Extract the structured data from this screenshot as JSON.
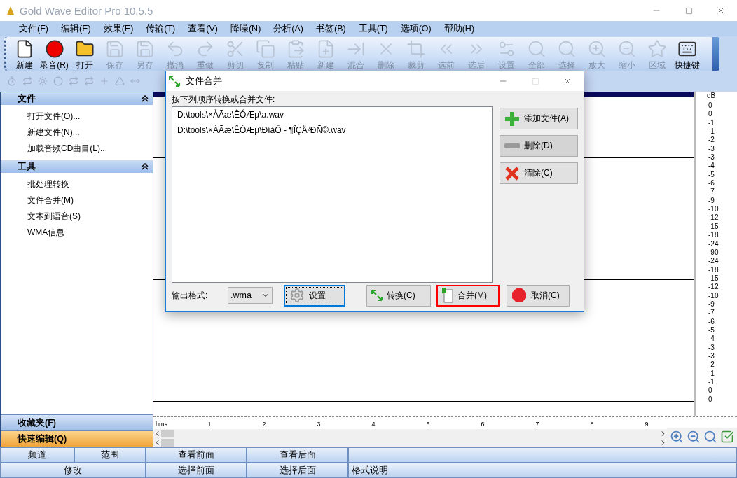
{
  "window": {
    "title": "Gold Wave Editor Pro 10.5.5"
  },
  "menu": [
    "文件(F)",
    "编辑(E)",
    "效果(E)",
    "传输(T)",
    "查看(V)",
    "降噪(N)",
    "分析(A)",
    "书签(B)",
    "工具(T)",
    "选项(O)",
    "帮助(H)"
  ],
  "toolbar": [
    {
      "label": "新建",
      "disabled": false
    },
    {
      "label": "录音(R)",
      "disabled": false
    },
    {
      "label": "打开",
      "disabled": false
    },
    {
      "label": "保存",
      "disabled": true
    },
    {
      "label": "另存",
      "disabled": true
    },
    {
      "label": "撤消",
      "disabled": true
    },
    {
      "label": "重做",
      "disabled": true
    },
    {
      "label": "剪切",
      "disabled": true
    },
    {
      "label": "复制",
      "disabled": true
    },
    {
      "label": "粘贴",
      "disabled": true
    },
    {
      "label": "新建",
      "disabled": true
    },
    {
      "label": "混合",
      "disabled": true
    },
    {
      "label": "删除",
      "disabled": true
    },
    {
      "label": "裁剪",
      "disabled": true
    },
    {
      "label": "选前",
      "disabled": true
    },
    {
      "label": "选后",
      "disabled": true
    },
    {
      "label": "设置",
      "disabled": true
    },
    {
      "label": "全部",
      "disabled": true
    },
    {
      "label": "选择",
      "disabled": true
    },
    {
      "label": "放大",
      "disabled": true
    },
    {
      "label": "缩小",
      "disabled": true
    },
    {
      "label": "区域",
      "disabled": true
    },
    {
      "label": "快捷键",
      "disabled": false
    }
  ],
  "sidebar": {
    "sections": [
      {
        "title": "文件",
        "expanded": true,
        "items": [
          "打开文件(O)...",
          "新建文件(N)...",
          "加载音频CD曲目(L)..."
        ]
      },
      {
        "title": "工具",
        "expanded": true,
        "items": [
          "批处理转换",
          "文件合并(M)",
          "文本到语音(S)",
          "WMA信息"
        ]
      }
    ],
    "panels": [
      {
        "label": "收藏夹(F)",
        "selected": false
      },
      {
        "label": "快速编辑(Q)",
        "selected": true
      }
    ]
  },
  "db_scale": {
    "unit": "dB",
    "labels": [
      "0",
      "0",
      "-1",
      "-1",
      "-2",
      "-3",
      "-3",
      "-4",
      "-5",
      "-6",
      "-7",
      "-9",
      "-10",
      "-12",
      "-15",
      "-18",
      "-24",
      "-90",
      "-24",
      "-18",
      "-15",
      "-12",
      "-10",
      "-9",
      "-7",
      "-6",
      "-5",
      "-4",
      "-3",
      "-3",
      "-2",
      "-1",
      "-1",
      "0",
      "0"
    ]
  },
  "time_ruler": {
    "unit": "hms",
    "labels": [
      "1",
      "2",
      "3",
      "4",
      "5",
      "6",
      "7",
      "8",
      "9"
    ]
  },
  "bottom_buttons": [
    [
      "频道",
      "范围",
      "查看前面",
      "查看后面"
    ],
    [
      "修改",
      "选择前面",
      "选择后面",
      "格式说明"
    ]
  ],
  "dialog": {
    "title": "文件合并",
    "instruction": "按下列顺序转换或合并文件:",
    "files": [
      "D:\\tools\\×ÀÃæ\\ÊÓÆµ\\a.wav",
      "D:\\tools\\×ÀÃæ\\ÊÓÆµ\\ÐíáÔ - ¶ÎÇÅ²ÐÑ©.wav"
    ],
    "side_buttons": [
      {
        "kind": "add",
        "label": "添加文件(A)",
        "hovered": false
      },
      {
        "kind": "remove",
        "label": "删除(D)",
        "hovered": true
      },
      {
        "kind": "clear",
        "label": "清除(C)",
        "hovered": false
      }
    ],
    "format": {
      "label": "输出格式:",
      "value": ".wma"
    },
    "buttons": [
      {
        "kind": "settings",
        "label": "设置",
        "focused": true,
        "marked": false
      },
      {
        "kind": "convert",
        "label": "转换(C)",
        "focused": false,
        "marked": false
      },
      {
        "kind": "merge",
        "label": "合并(M)",
        "focused": false,
        "marked": true
      },
      {
        "kind": "cancel",
        "label": "取消(C)",
        "focused": false,
        "marked": false
      }
    ]
  }
}
